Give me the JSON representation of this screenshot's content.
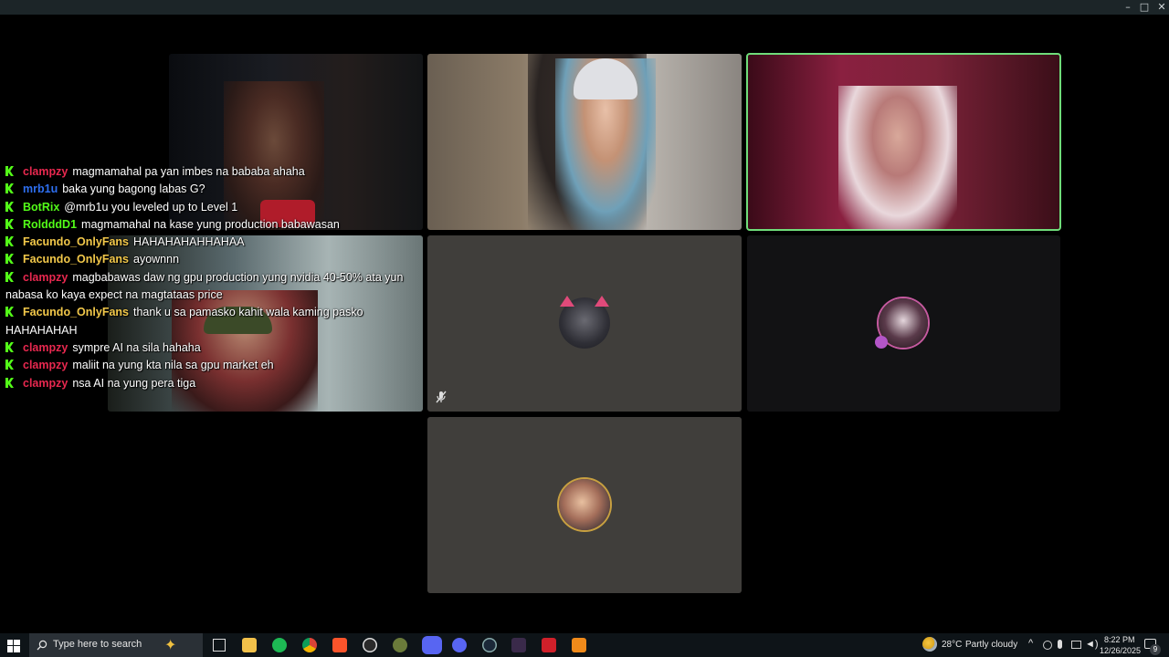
{
  "window": {
    "controls": {
      "minimize": "–",
      "maximize": "□",
      "close": "✕"
    }
  },
  "tiles": {
    "mic_muted_icon": "mic-muted-icon"
  },
  "chat": {
    "messages": [
      {
        "user": "clampzy",
        "color": "#e8284f",
        "text": "magmamahal pa yan imbes na bababa ahaha"
      },
      {
        "user": "mrb1u",
        "color": "#2e6ff0",
        "text": "baka yung bagong labas G?"
      },
      {
        "user": "BotRix",
        "color": "#53fc18",
        "text": "@mrb1u you leveled up to Level 1"
      },
      {
        "user": "RoldddD1",
        "color": "#53fc18",
        "text": "magmamahal na kase yung production babawasan"
      },
      {
        "user": "Facundo_OnlyFans",
        "color": "#f2c84a",
        "text": "HAHAHAHAHHAHAA"
      },
      {
        "user": "Facundo_OnlyFans",
        "color": "#f2c84a",
        "text": "ayownnn"
      },
      {
        "user": "clampzy",
        "color": "#e8284f",
        "text": "magbabawas daw ng gpu production yung nvidia 40-50% ata yun nabasa ko kaya expect na magtataas price"
      },
      {
        "user": "Facundo_OnlyFans",
        "color": "#f2c84a",
        "text": "thank u sa pamasko kahit wala kaming pasko HAHAHAHAH"
      },
      {
        "user": "clampzy",
        "color": "#e8284f",
        "text": "sympre AI na sila hahaha"
      },
      {
        "user": "clampzy",
        "color": "#e8284f",
        "text": "maliit na yung kta nila sa gpu market eh"
      },
      {
        "user": "clampzy",
        "color": "#e8284f",
        "text": "nsa AI na yung pera tiga"
      }
    ]
  },
  "taskbar": {
    "search_placeholder": "Type here to search",
    "weather_temp": "28°C",
    "weather_desc": "Partly cloudy",
    "time": "8:22 PM",
    "date": "12/26/2025",
    "notification_count": "9"
  },
  "colors": {
    "tile_gray": "#403e3b",
    "active_speaker": "#6fdc7a",
    "taskbar": "#0e1418"
  }
}
